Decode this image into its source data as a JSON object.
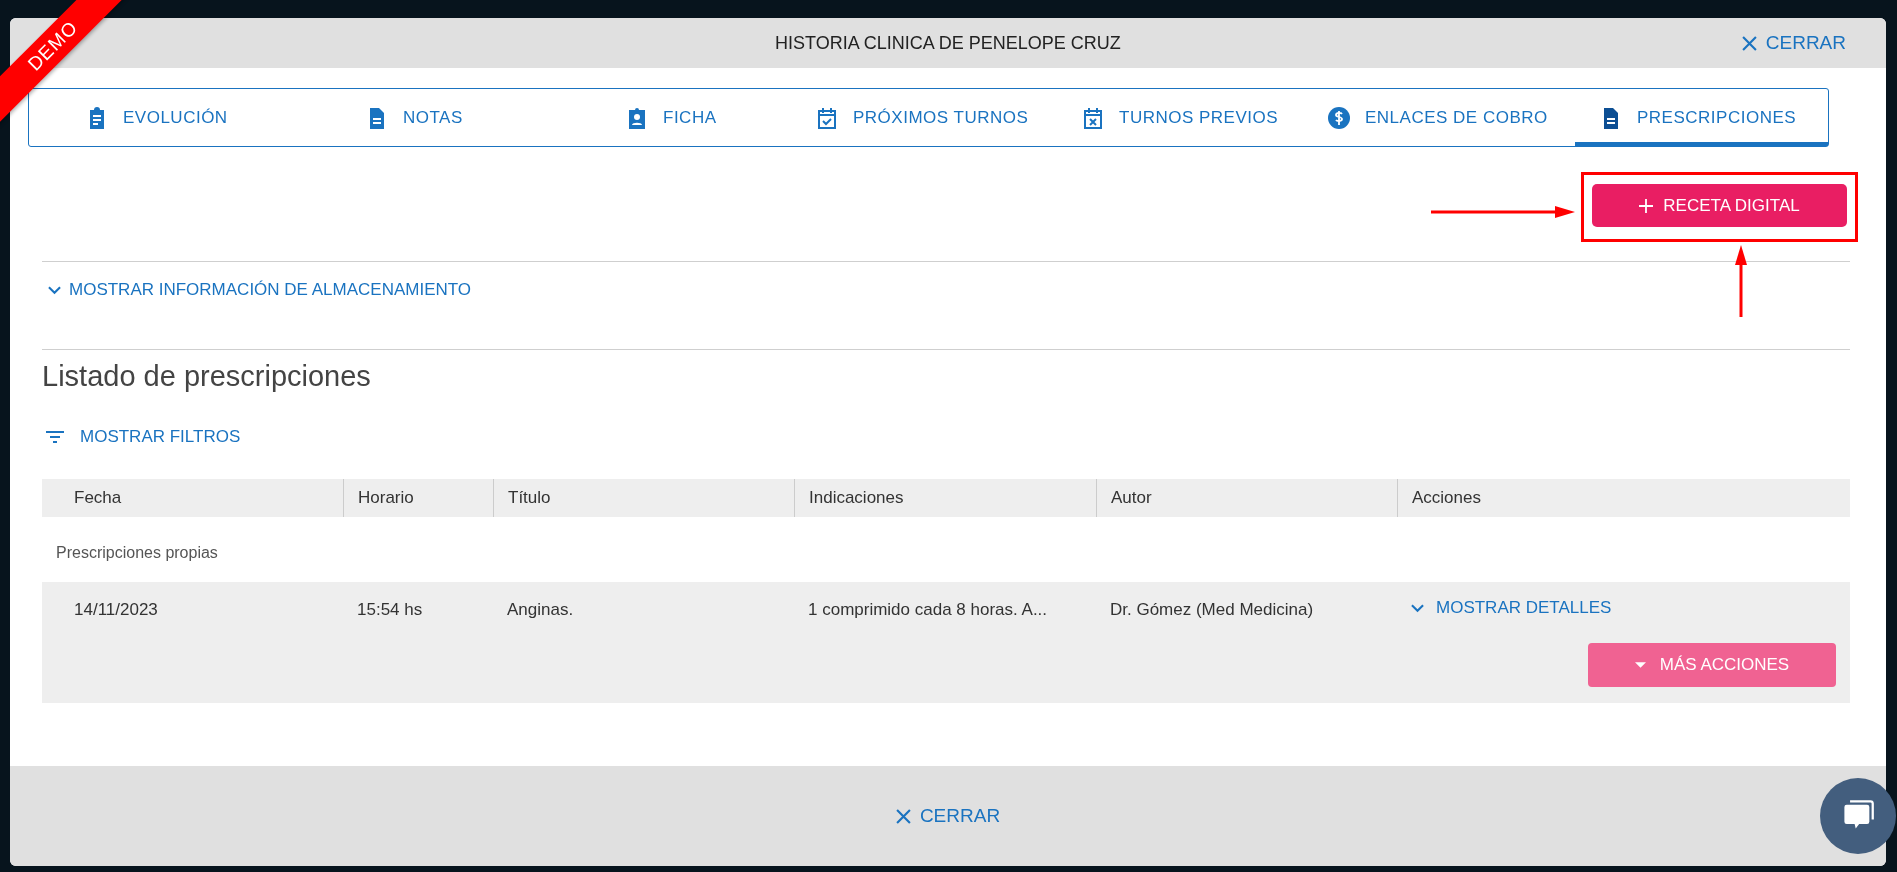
{
  "demo_ribbon": "DEMO",
  "window": {
    "title": "HISTORIA CLINICA DE PENELOPE CRUZ",
    "close": "CERRAR"
  },
  "tabs": [
    {
      "label": "EVOLUCIÓN",
      "kind": "clipboard",
      "selected": false
    },
    {
      "label": "NOTAS",
      "kind": "document",
      "selected": false
    },
    {
      "label": "FICHA",
      "kind": "badge",
      "selected": false
    },
    {
      "label": "PRÓXIMOS TURNOS",
      "kind": "appointments",
      "selected": false
    },
    {
      "label": "TURNOS PREVIOS",
      "kind": "history",
      "selected": false
    },
    {
      "label": "ENLACES DE COBRO",
      "kind": "payment",
      "selected": false
    },
    {
      "label": "PRESCRIPCIONES",
      "kind": "document",
      "selected": true
    }
  ],
  "new_prescription_button": "RECETA DIGITAL",
  "storage_toggle": "MOSTRAR INFORMACIÓN DE ALMACENAMIENTO",
  "section_title": "Listado de prescripciones",
  "filters_toggle": "MOSTRAR FILTROS",
  "table": {
    "columns": [
      "Fecha",
      "Horario",
      "Título",
      "Indicaciones",
      "Autor",
      "Acciones"
    ],
    "groups": [
      {
        "label": "Prescripciones propias",
        "rows": [
          {
            "fecha": "14/11/2023",
            "horario": "15:54 hs",
            "titulo": "Anginas.",
            "indicaciones": "1 comprimido cada 8 horas. A...",
            "autor": "Dr. Gómez (Med Medicina)",
            "details_toggle": "MOSTRAR DETALLES",
            "more_actions": "MÁS ACCIONES"
          }
        ]
      }
    ]
  },
  "footer": {
    "close": "CERRAR"
  }
}
